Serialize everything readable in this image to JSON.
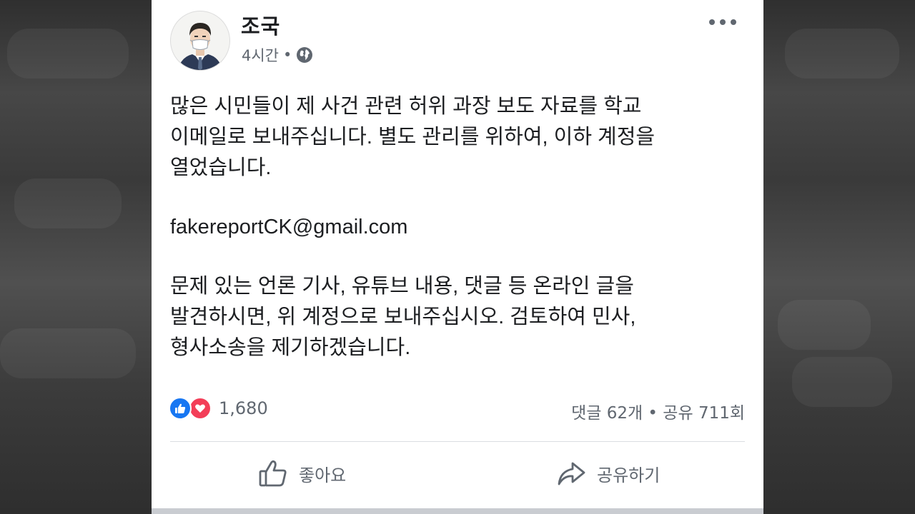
{
  "post": {
    "author": "조국",
    "time": "4시간",
    "separator": "•",
    "privacy_icon": "globe-icon",
    "menu_icon": "more-icon",
    "paragraphs": [
      "많은 시민들이 제 사건 관련 허위 과장 보도 자료를 학교\n이메일로 보내주십니다. 별도 관리를 위하여, 이하 계정을\n열었습니다.",
      "fakereportCK@gmail.com",
      "문제 있는 언론 기사, 유튜브 내용, 댓글 등 온라인 글을\n발견하시면, 위 계정으로 보내주십시오. 검토하여 민사,\n형사소송을 제기하겠습니다."
    ]
  },
  "engagement": {
    "reaction_icons": [
      "like-icon",
      "love-icon"
    ],
    "reaction_count": "1,680",
    "stats": "댓글 62개 • 공유 711회"
  },
  "actions": {
    "like_label": "좋아요",
    "share_label": "공유하기"
  },
  "colors": {
    "like_blue": "#1877f2",
    "love_red": "#f33e58",
    "text": "#1c1e21",
    "secondary_text": "#606770"
  }
}
